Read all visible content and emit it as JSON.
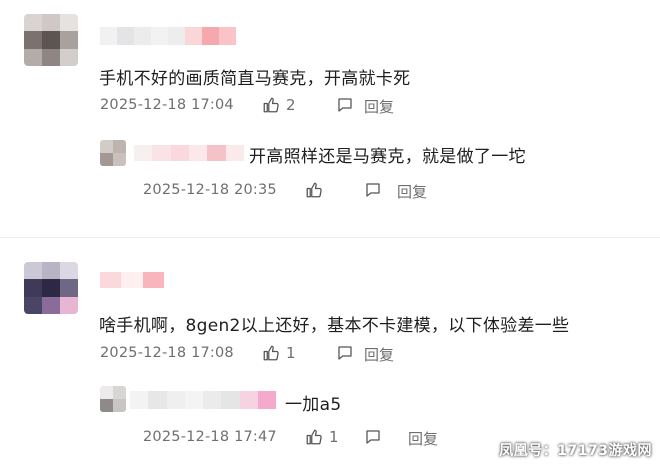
{
  "comments": [
    {
      "text": "手机不好的画质简直马赛克，开高就卡死",
      "time": "2025-12-18 17:04",
      "likes": "2",
      "reply_label": "回复",
      "replies": [
        {
          "text": "开高照样还是马赛克，就是做了一坨",
          "time": "2025-12-18 20:35",
          "likes": "",
          "reply_label": "回复"
        }
      ]
    },
    {
      "text": "啥手机啊，8gen2以上还好，基本不卡建模，以下体验差一些",
      "time": "2025-12-18 17:08",
      "likes": "1",
      "reply_label": "回复",
      "replies": [
        {
          "text": "一加a5",
          "time": "2025-12-18 17:47",
          "likes": "1",
          "reply_label": "回复"
        }
      ]
    }
  ],
  "watermark": "凤凰号：17173游戏网",
  "colors": {
    "text": "#1e1e1e",
    "meta": "#6f6f6f",
    "divider": "#ececec"
  }
}
